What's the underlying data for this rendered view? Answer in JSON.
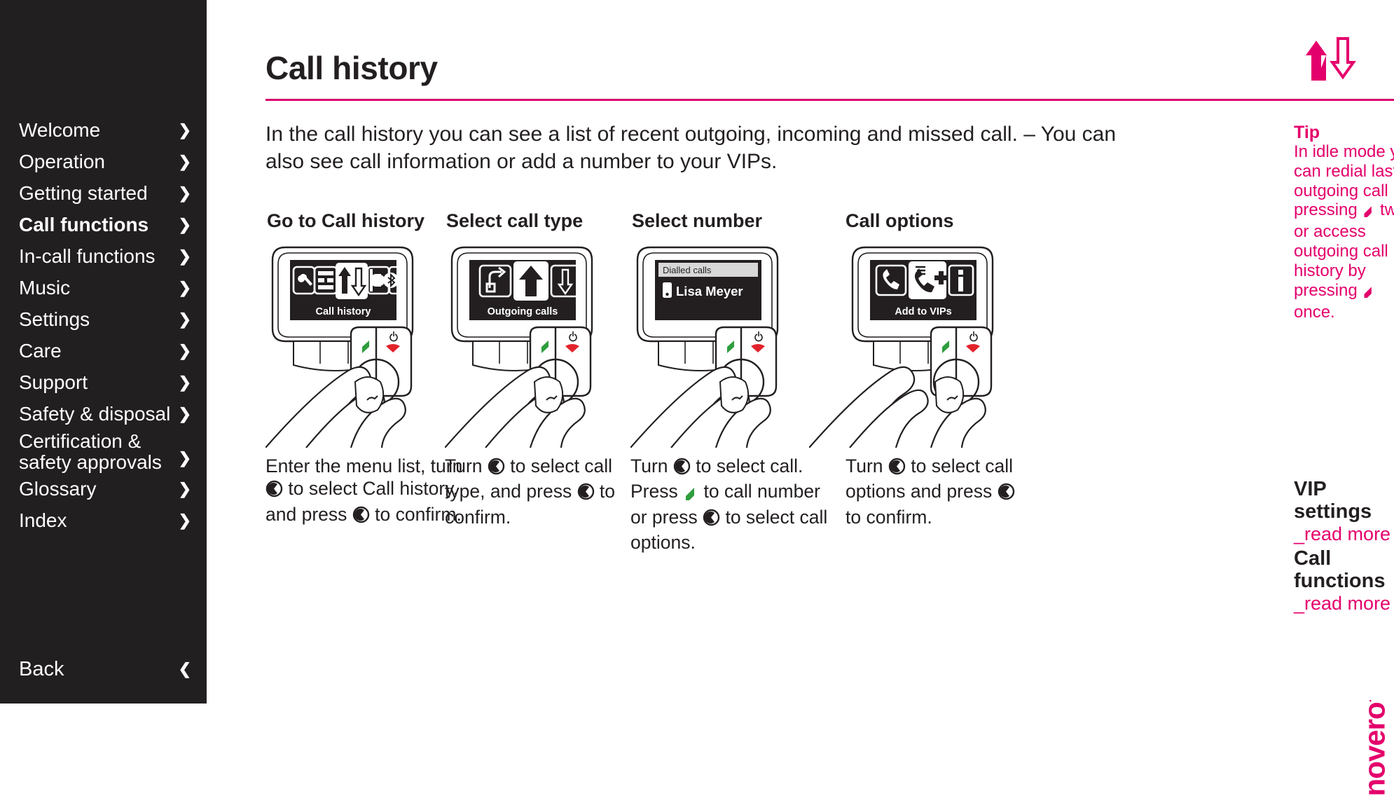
{
  "sidebar": {
    "items": [
      {
        "label": "Welcome",
        "active": false
      },
      {
        "label": "Operation",
        "active": false
      },
      {
        "label": "Getting started",
        "active": false
      },
      {
        "label": "Call functions",
        "active": true
      },
      {
        "label": "In-call functions",
        "active": false
      },
      {
        "label": "Music",
        "active": false
      },
      {
        "label": "Settings",
        "active": false
      },
      {
        "label": "Care",
        "active": false
      },
      {
        "label": "Support",
        "active": false
      },
      {
        "label": "Safety & disposal",
        "active": false
      },
      {
        "label": "Certification &",
        "label2": "safety approvals",
        "active": false
      },
      {
        "label": "Glossary",
        "active": false
      },
      {
        "label": "Index",
        "active": false
      }
    ],
    "back_label": "Back",
    "chevron_right": "❯",
    "chevron_left": "❮",
    "background": "#221f20"
  },
  "header": {
    "title": "Call history",
    "rule_color": "#d6006e",
    "nav_icon": "up-down-arrows-icon"
  },
  "intro": "In the call history you can see a list of recent outgoing, incoming and missed call. – You can also see call information or add a number to your VIPs.",
  "steps": [
    {
      "title": "Go to Call history",
      "screen_label": "Call history",
      "screen_icons": [
        "wrench-icon",
        "menu-list-icon",
        "up-down-arrows-icon",
        "phonebook-icon",
        "bluetooth-icon"
      ],
      "caption_parts": [
        "Enter the menu list, turn ",
        " to select Call history, and press ",
        " to confirm."
      ]
    },
    {
      "title": "Select call type",
      "screen_label": "Outgoing calls",
      "screen_icons": [
        "incoming-call-icon",
        "up-arrow-icon",
        "down-arrow-icon"
      ],
      "caption_parts": [
        "Turn ",
        " to select call type, and press ",
        " to confirm."
      ]
    },
    {
      "title": "Select number",
      "screen_label": "Dialled calls",
      "screen_entry": "Lisa Meyer",
      "screen_icons": [
        "mobile-phone-icon"
      ],
      "caption_parts": [
        "Turn ",
        " to select call. Press ",
        " to call number or press ",
        " to select call options."
      ]
    },
    {
      "title": "Call options",
      "screen_label": "Add to VIPs",
      "screen_icons": [
        "call-icon",
        "add-vip-icon",
        "info-icon"
      ],
      "caption_parts": [
        "Turn ",
        " to select call options and press ",
        " to confirm."
      ]
    }
  ],
  "tip": {
    "heading": "Tip",
    "text_1": "In idle mode you can redial last outgoing call by pressing ",
    "text_2": " twice or access outgoing call history by pressing ",
    "text_3": " once."
  },
  "related": [
    {
      "heading": "VIP settings",
      "link": "_read more"
    },
    {
      "heading": "Call functions",
      "link": "_read more"
    }
  ],
  "brand": {
    "name": "novero",
    "mark": "·"
  },
  "colors": {
    "accent": "#e4006c",
    "rule": "#d6006e",
    "sidebar_bg": "#221f20",
    "text": "#231f20",
    "green_key": "#2e9e3e",
    "red_key": "#e2232b"
  }
}
